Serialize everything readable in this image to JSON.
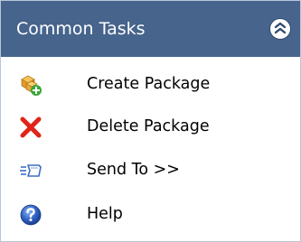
{
  "panel": {
    "title": "Common Tasks",
    "collapse_icon": "double-chevron-up-icon",
    "header_color": "#46648c"
  },
  "tasks": [
    {
      "label": "Create Package",
      "icon": "package-add-icon"
    },
    {
      "label": "Delete Package",
      "icon": "red-x-delete-icon"
    },
    {
      "label": "Send To >>",
      "icon": "send-to-icon"
    },
    {
      "label": "Help",
      "icon": "help-question-icon"
    }
  ]
}
